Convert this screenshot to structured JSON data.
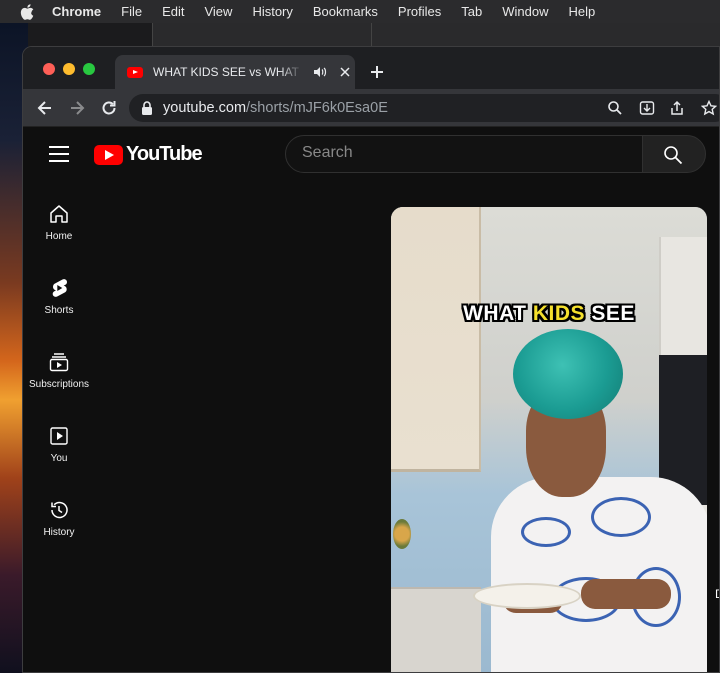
{
  "menubar": {
    "app": "Chrome",
    "items": [
      "File",
      "Edit",
      "View",
      "History",
      "Bookmarks",
      "Profiles",
      "Tab",
      "Window",
      "Help"
    ]
  },
  "browser": {
    "tab_title": "WHAT KIDS SEE vs WHAT PARENTS SEE",
    "url_host": "youtube.com",
    "url_path": "/shorts/mJF6k0Esa0E"
  },
  "youtube": {
    "logo_text": "YouTube",
    "search_placeholder": "Search",
    "sidebar": [
      {
        "label": "Home",
        "icon": "home-icon"
      },
      {
        "label": "Shorts",
        "icon": "shorts-icon"
      },
      {
        "label": "Subscriptions",
        "icon": "subscriptions-icon"
      },
      {
        "label": "You",
        "icon": "you-icon"
      },
      {
        "label": "History",
        "icon": "history-icon"
      }
    ],
    "short": {
      "caption_pre": "WHAT ",
      "caption_highlight": "KIDS",
      "caption_post": " SEE",
      "highlight_color": "#f5e02c"
    },
    "edge_letter": "D"
  },
  "colors": {
    "brand_red": "#ff0000",
    "background": "#0f0f0f"
  }
}
